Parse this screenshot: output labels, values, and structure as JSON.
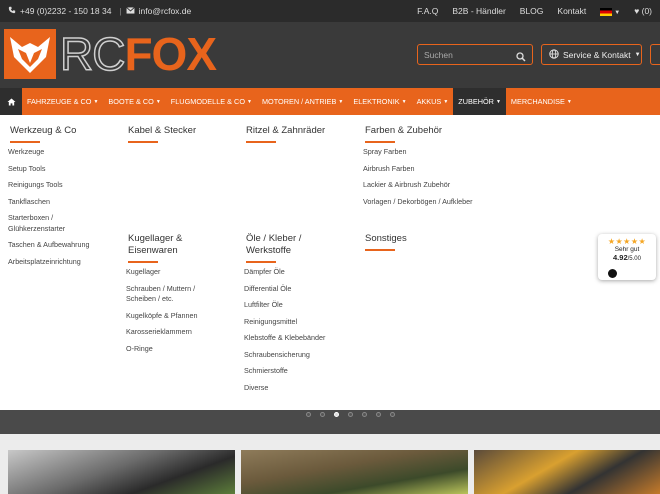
{
  "topbar": {
    "phone": "+49 (0)2232 - 150 18 34",
    "email": "info@rcfox.de",
    "links": [
      "F.A.Q",
      "B2B - Händler",
      "BLOG",
      "Kontakt"
    ],
    "wishlist": "(0)",
    "flag_icon": "germany-flag-icon"
  },
  "header": {
    "logo_rc": "RC",
    "logo_fox": "FOX",
    "search_placeholder": "Suchen",
    "service_label": "Service & Kontakt",
    "brand_color": "#e8641c"
  },
  "nav": {
    "items": [
      "FAHRZEUGE & CO",
      "BOOTE & CO",
      "FLUGMODELLE & CO",
      "MOTOREN / ANTRIEB",
      "ELEKTRONIK",
      "AKKUS",
      "ZUBEHÖR",
      "MERCHANDISE"
    ],
    "active": "ZUBEHÖR"
  },
  "mega": {
    "werkzeug": {
      "title": "Werkzeug & Co",
      "links": [
        "Werkzeuge",
        "Setup Tools",
        "Reinigungs Tools",
        "Tankflaschen",
        "Starterboxen / Glühkerzenstarter",
        "Taschen & Aufbewahrung",
        "Arbeitsplatzeinrichtung"
      ]
    },
    "kabel": {
      "title": "Kabel & Stecker"
    },
    "ritzel": {
      "title": "Ritzel & Zahnräder"
    },
    "farben": {
      "title": "Farben & Zubehör",
      "links": [
        "Spray Farben",
        "Airbrush Farben",
        "Lackier & Airbrush Zubehör",
        "Vorlagen / Dekorbögen / Aufkleber"
      ]
    },
    "kugellager": {
      "title": "Kugellager & Eisenwaren",
      "links": [
        "Kugellager",
        "Schrauben / Muttern / Scheiben / etc.",
        "Kugelköpfe & Pfannen",
        "Karosserieklammern",
        "O-Ringe"
      ]
    },
    "oele": {
      "title": "Öle / Kleber / Werkstoffe",
      "links": [
        "Dämpfer Öle",
        "Differential Öle",
        "Luftfilter Öle",
        "Reinigungsmittel",
        "Klebstoffe & Klebebänder",
        "Schraubensicherung",
        "Schmierstoffe",
        "Diverse"
      ]
    },
    "sonstiges": {
      "title": "Sonstiges"
    }
  },
  "badge": {
    "label": "Sehr gut",
    "rating": "4.92",
    "max": "/5.00"
  },
  "slider": {
    "slide_count": 7,
    "active_index": 2
  }
}
